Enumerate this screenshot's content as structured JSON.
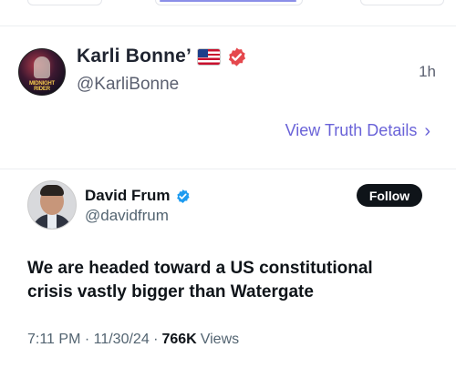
{
  "post": {
    "author_name": "Karli Bonne’",
    "handle": "@KarliBonne",
    "time": "1h",
    "avatar_text": "MIDNIGHT RIDER",
    "view_details_label": "View Truth Details",
    "accent_color": "#6a63d8",
    "verified_badge_color": "#e5484d"
  },
  "embedded_tweet": {
    "author_name": "David Frum",
    "handle": "@davidfrum",
    "follow_label": "Follow",
    "text_line1": "We are headed toward a US constitutional",
    "text_line2": "crisis vastly bigger than Watergate",
    "timestamp": "7:11 PM · 11/30/24 ·",
    "views_count": "766K",
    "views_label": "Views",
    "verified_badge_color": "#1d9bf0"
  }
}
